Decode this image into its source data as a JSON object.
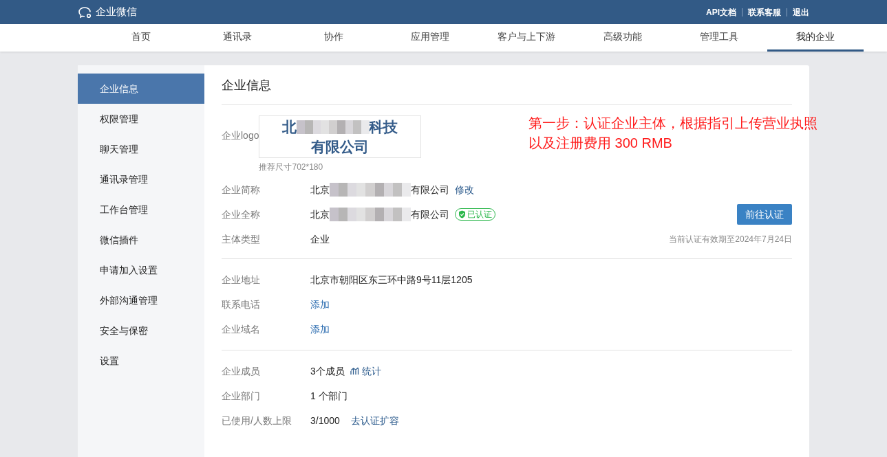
{
  "header": {
    "brand": "企业微信",
    "links": [
      "API文档",
      "联系客服",
      "退出"
    ]
  },
  "nav": [
    {
      "label": "首页",
      "selected": false
    },
    {
      "label": "通讯录",
      "selected": false
    },
    {
      "label": "协作",
      "selected": false
    },
    {
      "label": "应用管理",
      "selected": false
    },
    {
      "label": "客户与上下游",
      "selected": false
    },
    {
      "label": "高级功能",
      "selected": false
    },
    {
      "label": "管理工具",
      "selected": false
    },
    {
      "label": "我的企业",
      "selected": true
    }
  ],
  "sidebar": [
    {
      "label": "企业信息",
      "selected": true
    },
    {
      "label": "权限管理",
      "selected": false
    },
    {
      "label": "聊天管理",
      "selected": false
    },
    {
      "label": "通讯录管理",
      "selected": false
    },
    {
      "label": "工作台管理",
      "selected": false
    },
    {
      "label": "微信插件",
      "selected": false
    },
    {
      "label": "申请加入设置",
      "selected": false
    },
    {
      "label": "外部沟通管理",
      "selected": false
    },
    {
      "label": "安全与保密",
      "selected": false
    },
    {
      "label": "设置",
      "selected": false
    }
  ],
  "content": {
    "title": "企业信息",
    "logo": {
      "label": "企业logo",
      "line1_start": "北",
      "line1_end": "科技",
      "line2": "有限公司",
      "hint": "推荐尺寸702*180"
    },
    "short_name": {
      "label": "企业简称",
      "value_start": "北京",
      "value_end": "有限公司",
      "action": "修改"
    },
    "full_name": {
      "label": "企业全称",
      "value_start": "北京",
      "value_end": "有限公司",
      "badge": "已认证",
      "verified": true
    },
    "entity_type": {
      "label": "主体类型",
      "value": "企业"
    },
    "verify_button": "前往认证",
    "validity": "当前认证有效期至2024年7月24日",
    "annotation": [
      "第一步：认证企业主体，根据指引上传营业执照",
      "以及注册费用 300 RMB"
    ],
    "contact_rows": [
      {
        "label": "企业地址",
        "value": "北京市朝阳区东三环中路9号11层1205",
        "kind": "text"
      },
      {
        "label": "联系电话",
        "value": "添加",
        "kind": "link"
      },
      {
        "label": "企业域名",
        "value": "添加",
        "kind": "link"
      }
    ],
    "member_rows": [
      {
        "label": "企业成员",
        "value": "3个成员",
        "action": "统计",
        "kind": "stats"
      },
      {
        "label": "企业部门",
        "value": "1 个部门",
        "kind": "text"
      },
      {
        "label": "已使用/人数上限",
        "value": "3/1000",
        "action": "去认证扩容",
        "kind": "action"
      }
    ]
  }
}
